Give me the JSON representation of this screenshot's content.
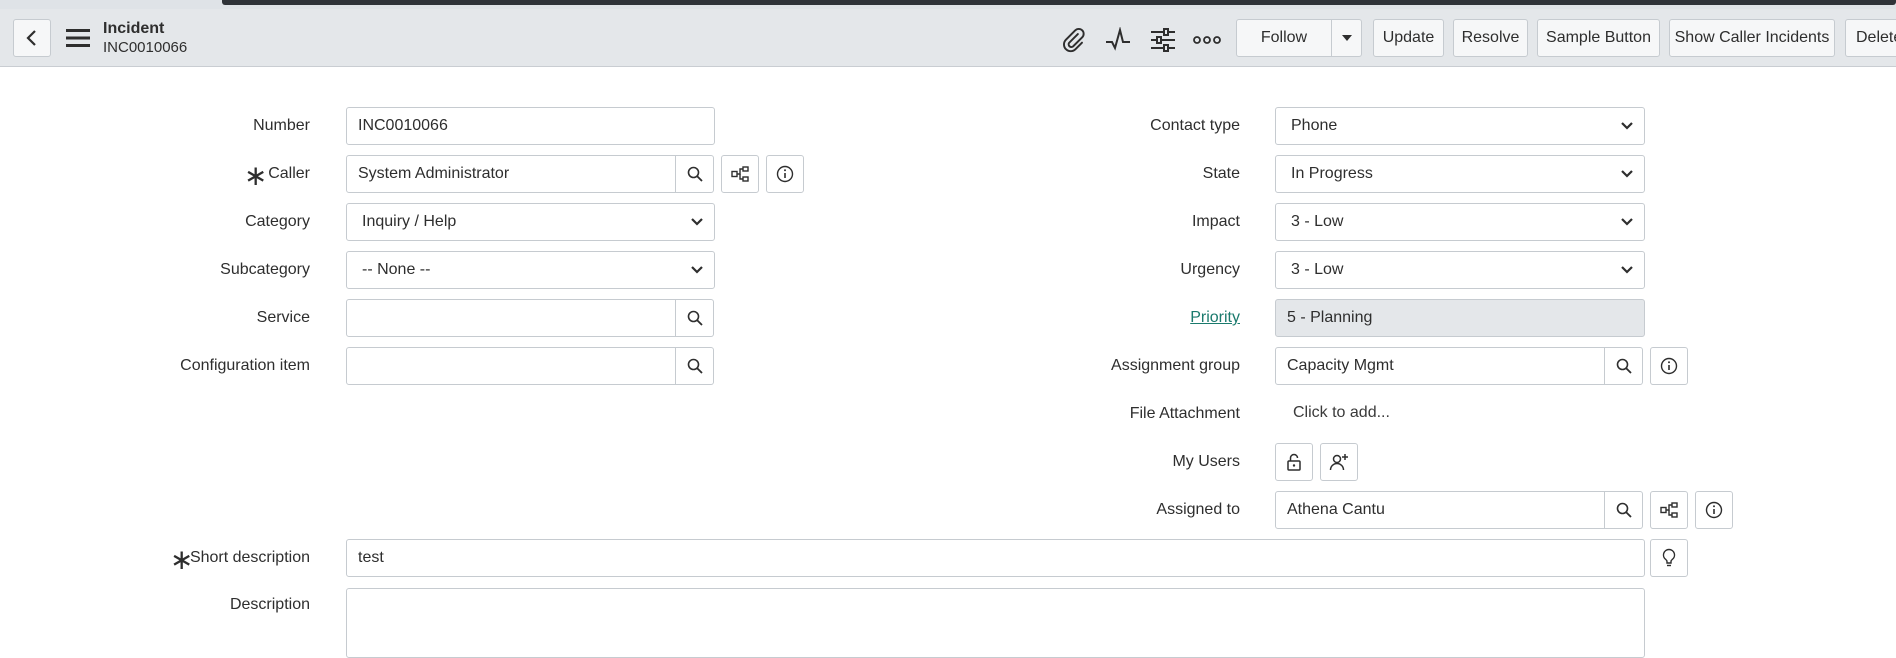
{
  "header": {
    "title": "Incident",
    "number": "INC0010066",
    "buttons": {
      "follow": "Follow",
      "update": "Update",
      "resolve": "Resolve",
      "sample": "Sample Button",
      "show_caller": "Show Caller Incidents",
      "delete": "Delete"
    }
  },
  "form": {
    "number": {
      "label": "Number",
      "value": "INC0010066"
    },
    "caller": {
      "label": "Caller",
      "value": "System Administrator"
    },
    "category": {
      "label": "Category",
      "value": "Inquiry / Help"
    },
    "subcategory": {
      "label": "Subcategory",
      "value": "-- None --"
    },
    "service": {
      "label": "Service",
      "value": ""
    },
    "configuration_item": {
      "label": "Configuration item",
      "value": ""
    },
    "contact_type": {
      "label": "Contact type",
      "value": "Phone"
    },
    "state": {
      "label": "State",
      "value": "In Progress"
    },
    "impact": {
      "label": "Impact",
      "value": "3 - Low"
    },
    "urgency": {
      "label": "Urgency",
      "value": "3 - Low"
    },
    "priority": {
      "label": "Priority",
      "value": "5 - Planning"
    },
    "assignment_group": {
      "label": "Assignment group",
      "value": "Capacity Mgmt"
    },
    "file_attachment": {
      "label": "File Attachment",
      "value": "Click to add..."
    },
    "my_users": {
      "label": "My Users"
    },
    "assigned_to": {
      "label": "Assigned to",
      "value": "Athena Cantu"
    },
    "short_description": {
      "label": "Short description",
      "value": "test"
    },
    "description": {
      "label": "Description",
      "value": ""
    }
  },
  "colors": {
    "header_bg": "#e4e7ea",
    "link": "#1a7a6d",
    "border": "#c6cbd0",
    "readonly_bg": "#e4e7ea"
  }
}
